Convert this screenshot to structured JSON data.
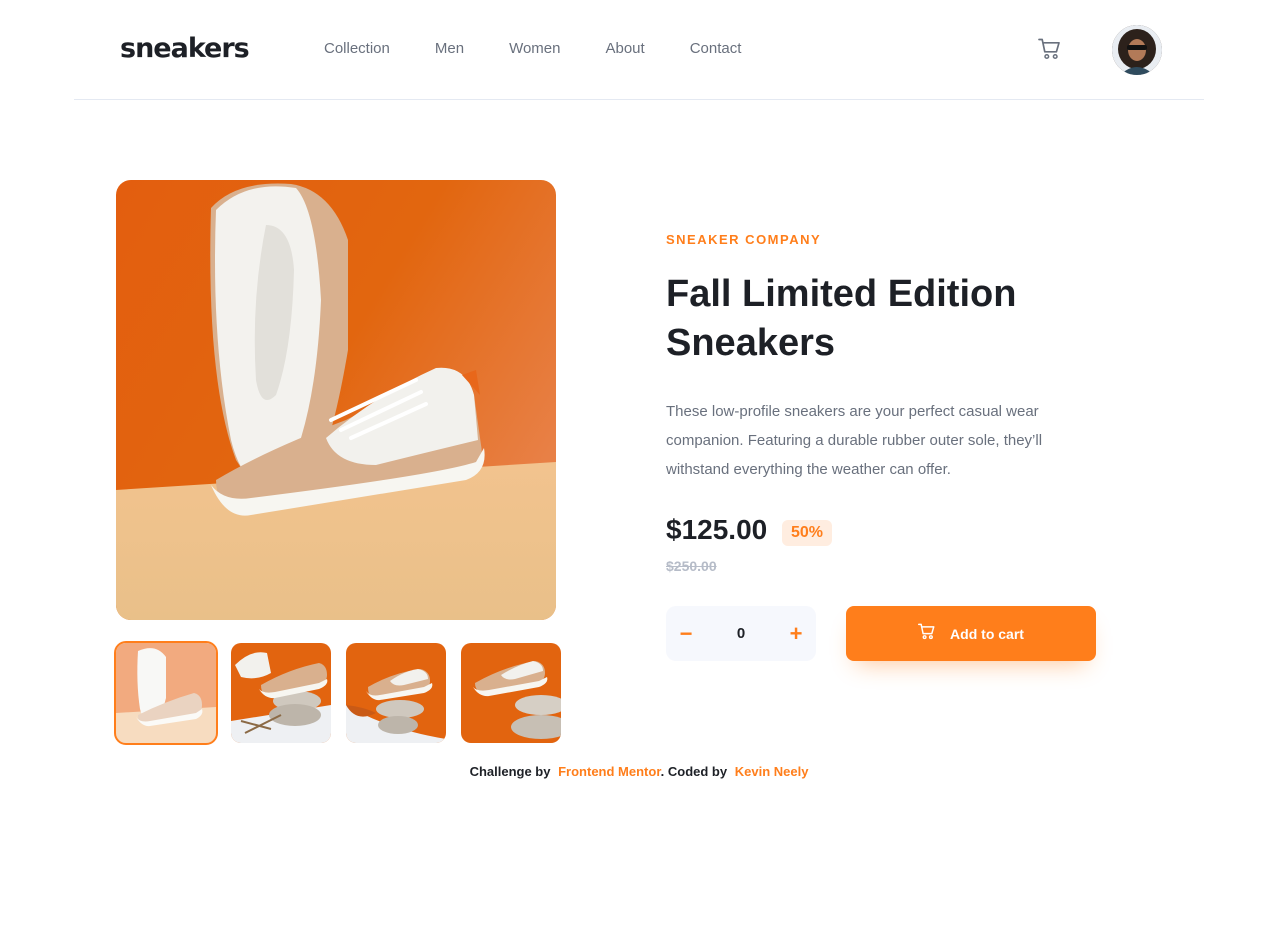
{
  "header": {
    "logo": "sneakers",
    "nav": [
      "Collection",
      "Men",
      "Women",
      "About",
      "Contact"
    ],
    "cart_icon": "cart-icon",
    "avatar_icon": "user-avatar"
  },
  "gallery": {
    "main_image": "sneaker-photo-1",
    "thumbnails": [
      "thumbnail-1",
      "thumbnail-2",
      "thumbnail-3",
      "thumbnail-4"
    ],
    "active_index": 0
  },
  "product": {
    "company": "SNEAKER COMPANY",
    "title": "Fall Limited Edition Sneakers",
    "description": "These low-profile sneakers are your perfect casual wear companion. Featuring a durable rubber outer sole, they’ll withstand everything the weather can offer.",
    "price": "$125.00",
    "discount": "50%",
    "original_price": "$250.00"
  },
  "quantity": {
    "minus": "−",
    "value": "0",
    "plus": "+"
  },
  "add_to_cart": {
    "label": "Add to cart",
    "icon": "cart-icon"
  },
  "attribution": {
    "prefix": "Challenge by",
    "link1": "Frontend Mentor",
    "middle": ". Coded by",
    "link2": "Kevin Neely"
  },
  "colors": {
    "accent": "#ff7e1b",
    "accent_pale": "#ffede0",
    "text_dark": "#1d2026",
    "text_grey": "#69707d",
    "qty_bg": "#f6f8fd"
  }
}
